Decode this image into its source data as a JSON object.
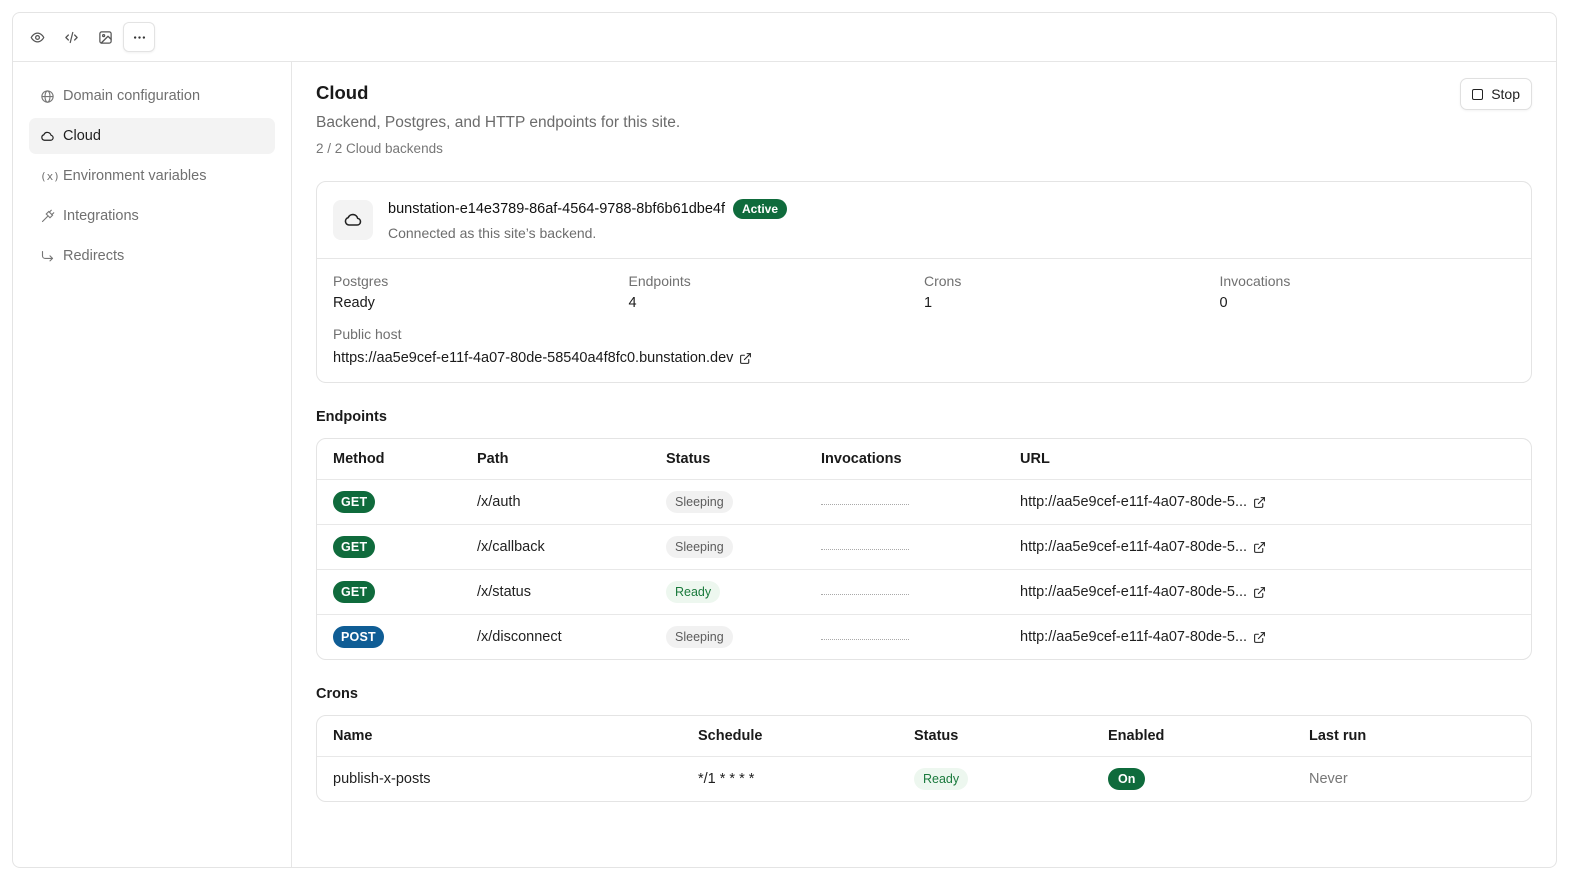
{
  "toolbar": {
    "tools": [
      "eye-icon",
      "code-icon",
      "image-icon",
      "more-icon"
    ]
  },
  "sidebar": {
    "items": [
      {
        "label": "Domain configuration",
        "icon": "globe-icon"
      },
      {
        "label": "Cloud",
        "icon": "cloud-icon",
        "selected": true
      },
      {
        "label": "Environment variables",
        "icon": "fx-icon",
        "glyph": "(x)"
      },
      {
        "label": "Integrations",
        "icon": "plug-icon"
      },
      {
        "label": "Redirects",
        "icon": "redirect-icon"
      }
    ]
  },
  "page": {
    "title": "Cloud",
    "subtitle": "Backend, Postgres, and HTTP endpoints for this site.",
    "count": "2 / 2 Cloud backends",
    "stop_label": "Stop"
  },
  "backend": {
    "name": "bunstation-e14e3789-86af-4564-9788-8bf6b61dbe4f",
    "badge": "Active",
    "subtitle": "Connected as this site’s backend.",
    "stats": [
      {
        "label": "Postgres",
        "value": "Ready"
      },
      {
        "label": "Endpoints",
        "value": "4"
      },
      {
        "label": "Crons",
        "value": "1"
      },
      {
        "label": "Invocations",
        "value": "0"
      }
    ],
    "host_label": "Public host",
    "host_url": "https://aa5e9cef-e11f-4a07-80de-58540a4f8fc0.bunstation.dev"
  },
  "endpoints": {
    "title": "Endpoints",
    "headers": {
      "method": "Method",
      "path": "Path",
      "status": "Status",
      "invocations": "Invocations",
      "url": "URL"
    },
    "rows": [
      {
        "method": "GET",
        "path": "/x/auth",
        "status": "Sleeping",
        "url": "http://aa5e9cef-e11f-4a07-80de-5..."
      },
      {
        "method": "GET",
        "path": "/x/callback",
        "status": "Sleeping",
        "url": "http://aa5e9cef-e11f-4a07-80de-5..."
      },
      {
        "method": "GET",
        "path": "/x/status",
        "status": "Ready",
        "url": "http://aa5e9cef-e11f-4a07-80de-5..."
      },
      {
        "method": "POST",
        "path": "/x/disconnect",
        "status": "Sleeping",
        "url": "http://aa5e9cef-e11f-4a07-80de-5..."
      }
    ]
  },
  "crons": {
    "title": "Crons",
    "headers": {
      "name": "Name",
      "schedule": "Schedule",
      "status": "Status",
      "enabled": "Enabled",
      "last_run": "Last run"
    },
    "rows": [
      {
        "name": "publish-x-posts",
        "schedule": "*/1 * * * *",
        "status": "Ready",
        "enabled": "On",
        "last_run": "Never"
      }
    ]
  },
  "colors": {
    "accent_green": "#0f6b3c",
    "accent_blue": "#0f5d95"
  }
}
